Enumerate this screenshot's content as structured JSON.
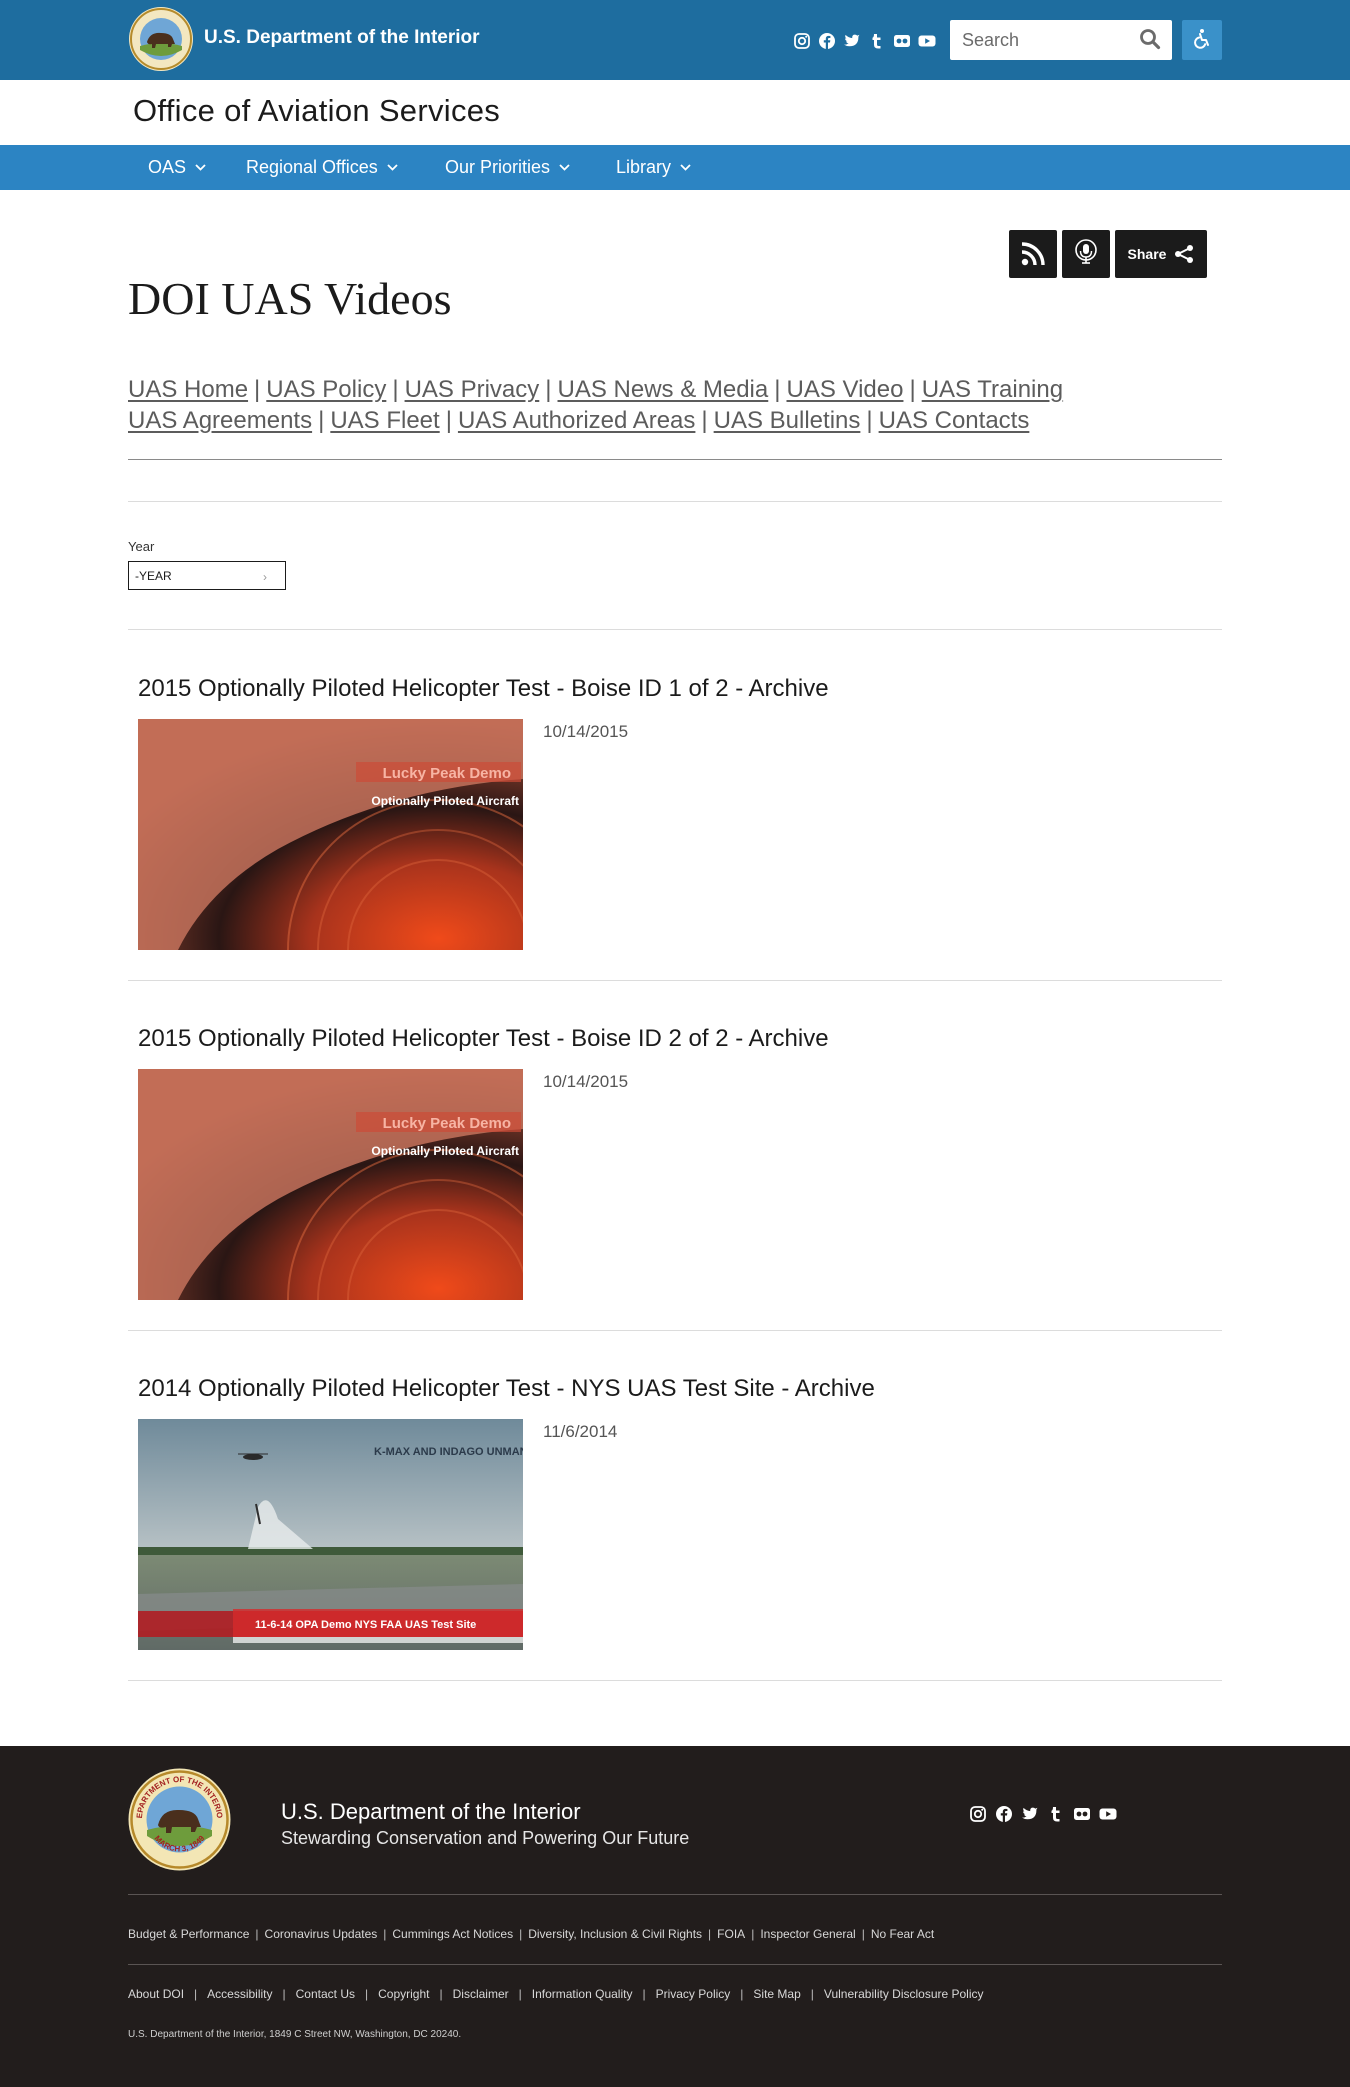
{
  "header": {
    "agency_name": "U.S. Department of the Interior",
    "seal_text": "DEPARTMENT OF THE INTERIOR",
    "search_placeholder": "Search",
    "social_icons": [
      "instagram-icon",
      "facebook-icon",
      "twitter-icon",
      "tumblr-icon",
      "flickr-icon",
      "youtube-icon"
    ],
    "accessibility_icon": "accessibility-icon",
    "colors": {
      "top_bar": "#1e6d9f",
      "nav_bar": "#2c84c3",
      "accessibility_button": "#3a91c9"
    }
  },
  "office_title": "Office of Aviation Services",
  "nav": {
    "items": [
      {
        "label": "OAS"
      },
      {
        "label": "Regional Offices"
      },
      {
        "label": "Our Priorities"
      },
      {
        "label": "Library"
      }
    ]
  },
  "actions": {
    "rss_icon": "rss-icon",
    "podcast_icon": "podcast-icon",
    "share_label": "Share",
    "share_icon": "share-icon"
  },
  "page_title": "DOI UAS Videos",
  "sublinks": {
    "row1": [
      "UAS Home",
      "UAS Policy",
      "UAS Privacy",
      "UAS News & Media",
      "UAS Video",
      "UAS Training"
    ],
    "row2": [
      "UAS Agreements",
      "UAS Fleet",
      "UAS Authorized Areas",
      "UAS Bulletins",
      "UAS Contacts"
    ]
  },
  "filter": {
    "label": "Year",
    "selected": "-YEAR"
  },
  "videos": [
    {
      "title": "2015 Optionally Piloted Helicopter Test - Boise ID 1 of 2 - Archive",
      "date": "10/14/2015",
      "thumb_line1": "Lucky Peak Demo",
      "thumb_line2": "Optionally Piloted Aircraft"
    },
    {
      "title": "2015 Optionally Piloted Helicopter Test - Boise ID 2 of 2 - Archive",
      "date": "10/14/2015",
      "thumb_line1": "Lucky Peak Demo",
      "thumb_line2": "Optionally Piloted Aircraft"
    },
    {
      "title": "2014 Optionally Piloted Helicopter Test - NYS UAS Test Site - Archive",
      "date": "11/6/2014",
      "thumb_line1": "K-MAX AND INDAGO UNMANNED DE",
      "thumb_line2": "11-6-14 OPA Demo NYS FAA UAS Test Site"
    }
  ],
  "footer": {
    "org_name": "U.S. Department of the Interior",
    "tagline": "Stewarding Conservation and Powering Our Future",
    "seal_bottom_text": "MARCH 3, 1849",
    "links_row1": [
      "Budget & Performance",
      "Coronavirus Updates",
      "Cummings Act Notices",
      "Diversity, Inclusion & Civil Rights",
      "FOIA",
      "Inspector General",
      "No Fear Act"
    ],
    "links_row2": [
      "About DOI",
      "Accessibility",
      "Contact Us",
      "Copyright",
      "Disclaimer",
      "Information Quality",
      "Privacy Policy",
      "Site Map",
      "Vulnerability Disclosure Policy"
    ],
    "address": "U.S. Department of the Interior, 1849 C Street NW, Washington, DC 20240.",
    "colors": {
      "background": "#221d1c"
    }
  }
}
